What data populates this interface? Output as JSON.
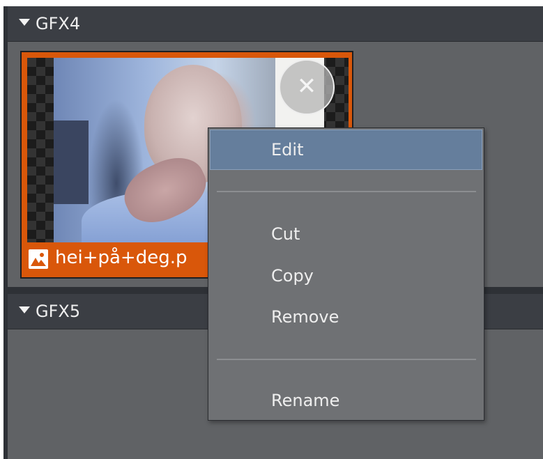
{
  "sections": [
    {
      "title": "GFX4"
    },
    {
      "title": "GFX5"
    }
  ],
  "asset": {
    "file_name": "hei+på+deg.p",
    "type_icon": "image-icon",
    "close_icon": "close-icon",
    "close_glyph": "✕"
  },
  "context_menu": {
    "items": [
      {
        "label": "Edit",
        "highlighted": true
      },
      {
        "label": "Cut"
      },
      {
        "label": "Copy"
      },
      {
        "label": "Remove"
      },
      {
        "label": "Rename"
      }
    ]
  },
  "colors": {
    "selection_border": "#d9570a",
    "menu_highlight": "#657e9c",
    "panel_background": "#606265",
    "header_background": "#3b3e44"
  }
}
